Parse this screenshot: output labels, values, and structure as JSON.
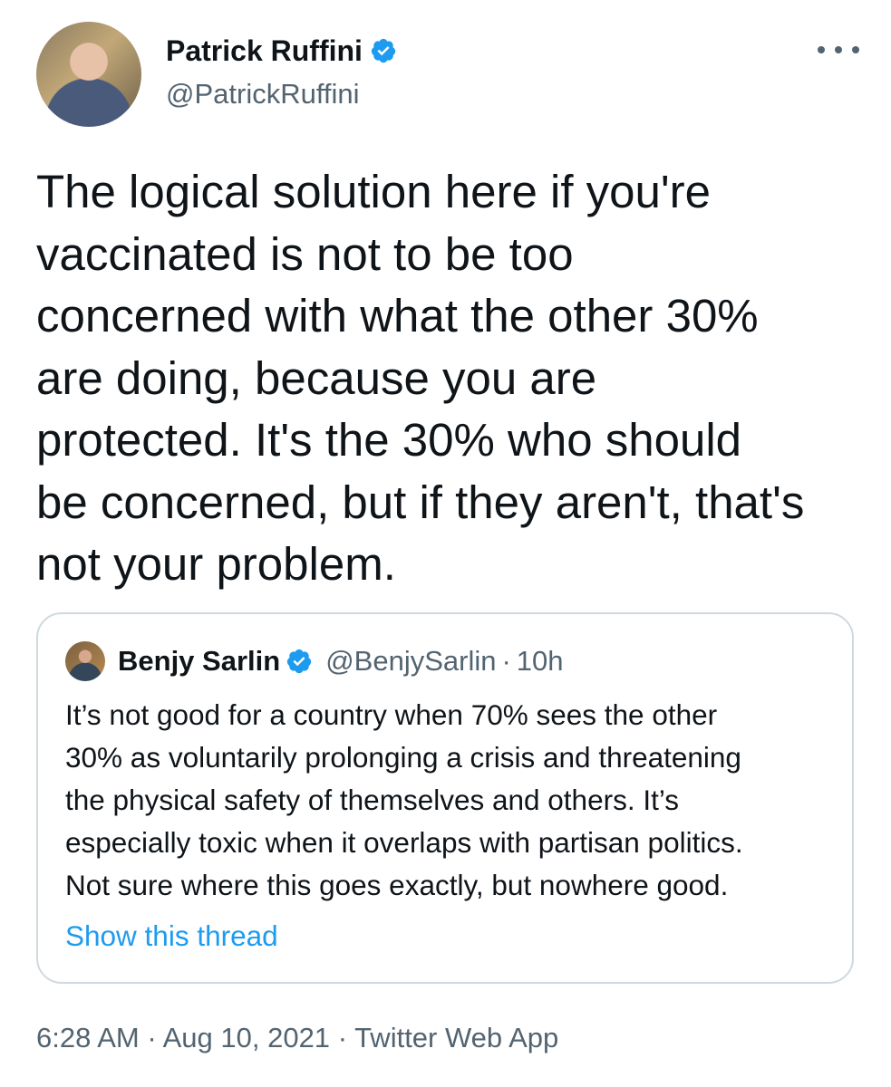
{
  "author": {
    "name": "Patrick Ruffini",
    "handle": "@PatrickRuffini",
    "verified": true
  },
  "icons": {
    "verified": "verified-badge-icon",
    "more": "more-options-icon"
  },
  "colors": {
    "verified": "#1d9bf0",
    "link": "#1d9bf0",
    "secondary_text": "#536471",
    "border": "#cfd9de"
  },
  "tweet": {
    "text": "The logical solution here if you're\nvaccinated is not to be too\nconcerned with what the other 30%\nare doing, because you are\nprotected. It's the 30% who should\nbe concerned, but if they aren't, that's\nnot your problem."
  },
  "quote": {
    "name": "Benjy Sarlin",
    "handle": "@BenjySarlin",
    "separator": "·",
    "time": "10h",
    "verified": true,
    "text": "It’s not good for a country when 70% sees the other\n30% as voluntarily prolonging a crisis and threatening\nthe physical safety of themselves and others. It’s\nespecially toxic when it overlaps with partisan politics.\nNot sure where this goes exactly, but nowhere good.",
    "show_thread": "Show this thread"
  },
  "meta": {
    "time": "6:28 AM",
    "date": "Aug 10, 2021",
    "source": "Twitter Web App",
    "separator": "·"
  }
}
